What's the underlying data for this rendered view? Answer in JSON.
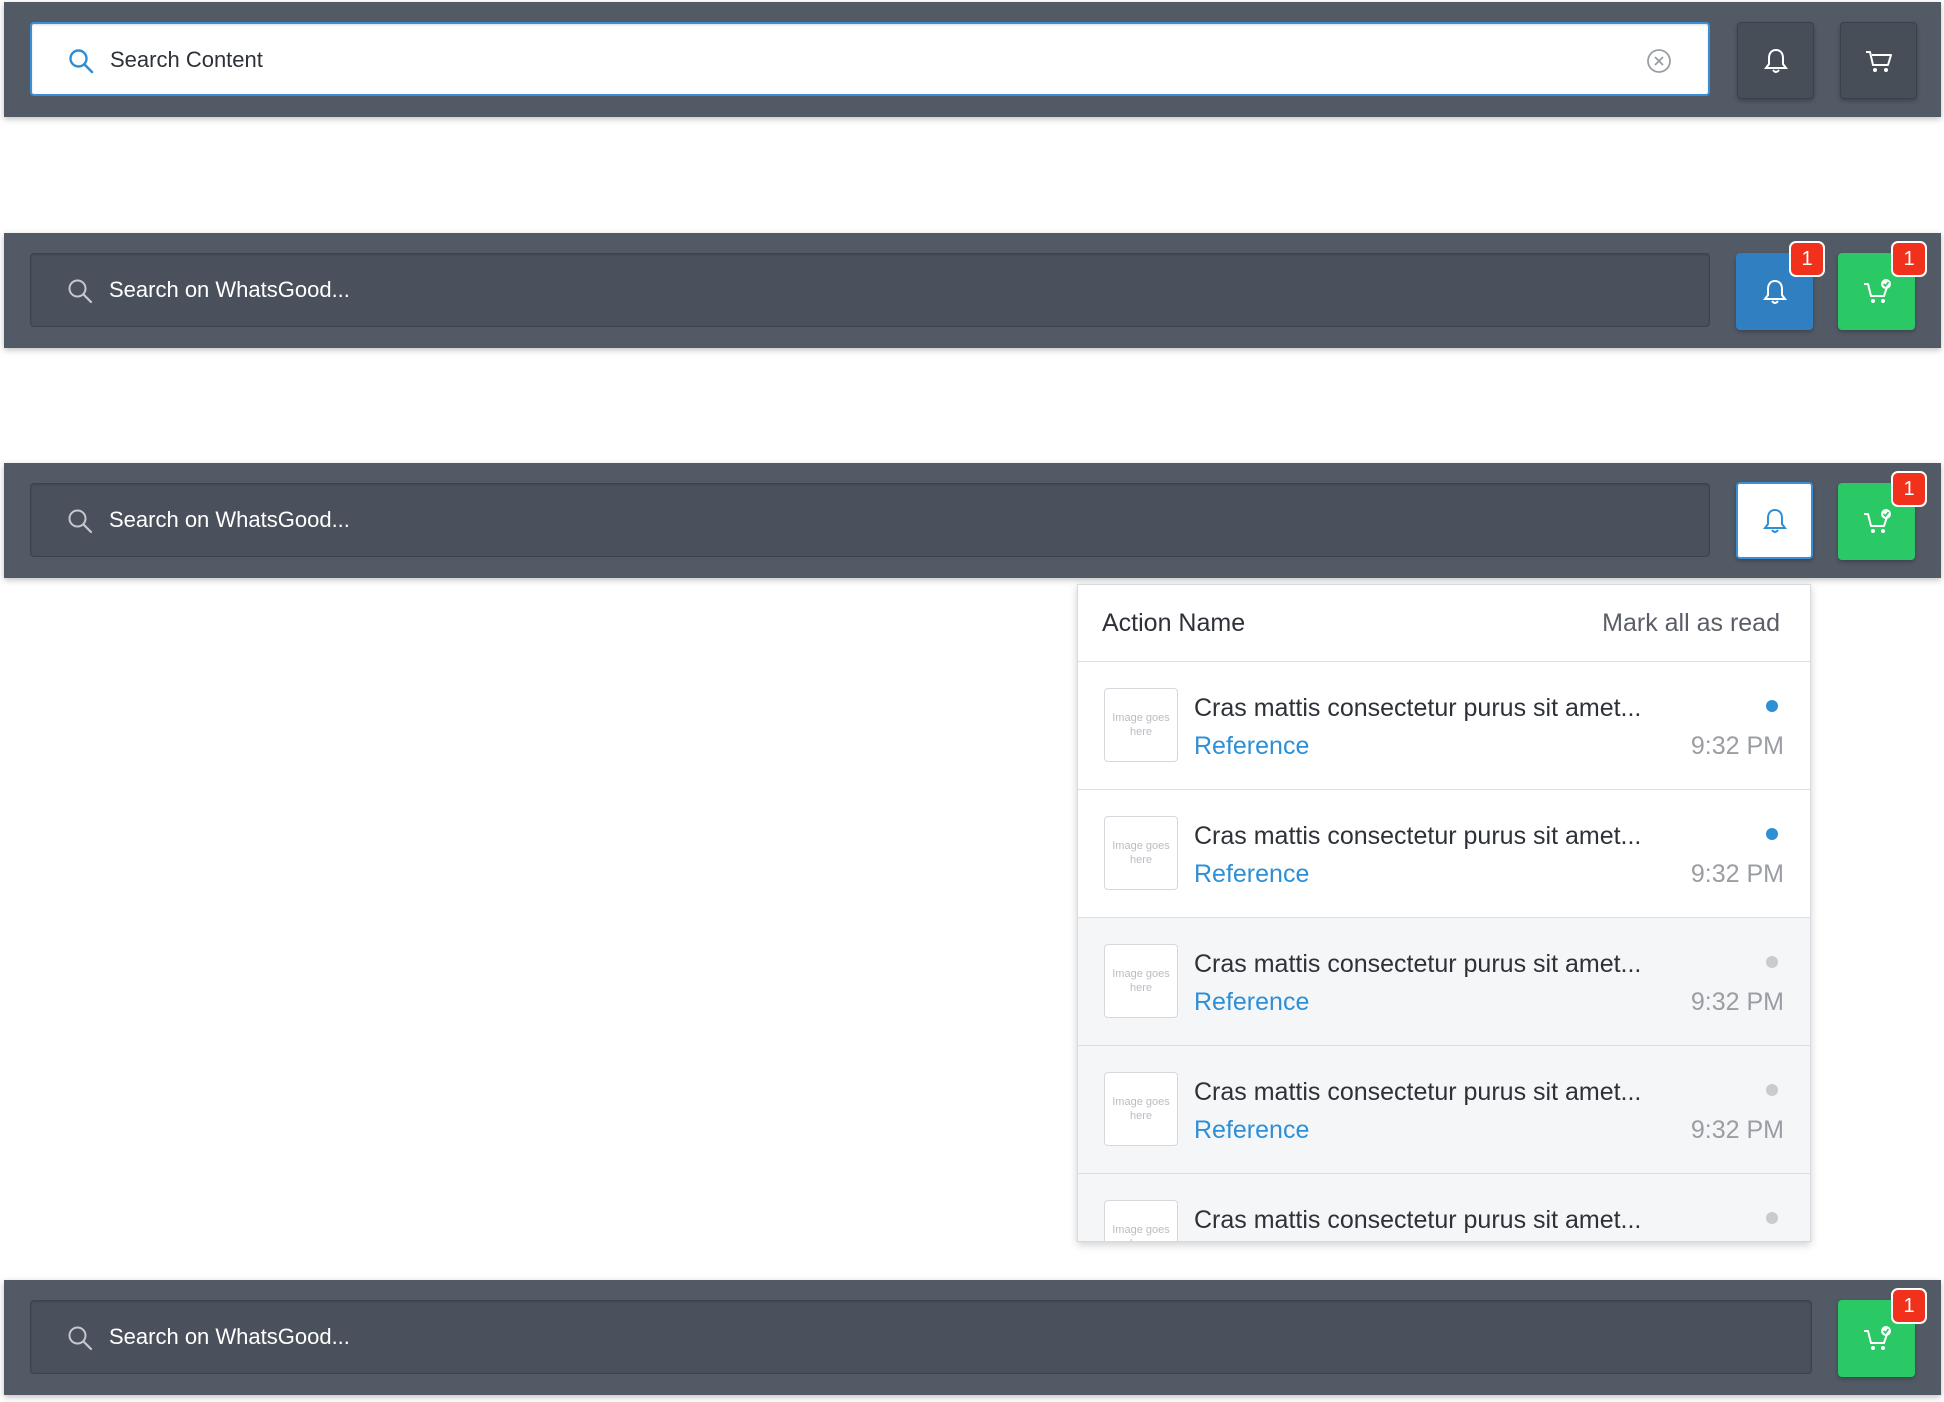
{
  "bar1": {
    "search_text": "Search Content",
    "search_icon": "search-icon",
    "clear_icon": "clear-icon",
    "bell_icon": "bell-icon",
    "cart_icon": "cart-icon"
  },
  "bar2": {
    "search_placeholder": "Search on WhatsGood...",
    "bell_badge": "1",
    "cart_badge": "1"
  },
  "bar3": {
    "search_placeholder": "Search on WhatsGood...",
    "cart_badge": "1"
  },
  "notifications": {
    "title": "Action Name",
    "mark_all_label": "Mark all as read",
    "thumb_placeholder": "Image goes here",
    "items": [
      {
        "text": "Cras mattis consectetur purus sit amet...",
        "reference": "Reference",
        "time": "9:32 PM",
        "status": "unread"
      },
      {
        "text": "Cras mattis consectetur purus sit amet...",
        "reference": "Reference",
        "time": "9:32 PM",
        "status": "unread"
      },
      {
        "text": "Cras mattis consectetur purus sit amet...",
        "reference": "Reference",
        "time": "9:32 PM",
        "status": "read"
      },
      {
        "text": "Cras mattis consectetur purus sit amet...",
        "reference": "Reference",
        "time": "9:32 PM",
        "status": "read"
      },
      {
        "text": "Cras mattis consectetur purus sit amet...",
        "status": "read"
      }
    ]
  },
  "bar4": {
    "search_placeholder": "Search on WhatsGood...",
    "cart_badge": "1"
  },
  "colors": {
    "bar": "#525a66",
    "blue": "#2f7fc1",
    "green": "#2bc866",
    "badge": "#f2311d",
    "link": "#2f8fd4"
  }
}
